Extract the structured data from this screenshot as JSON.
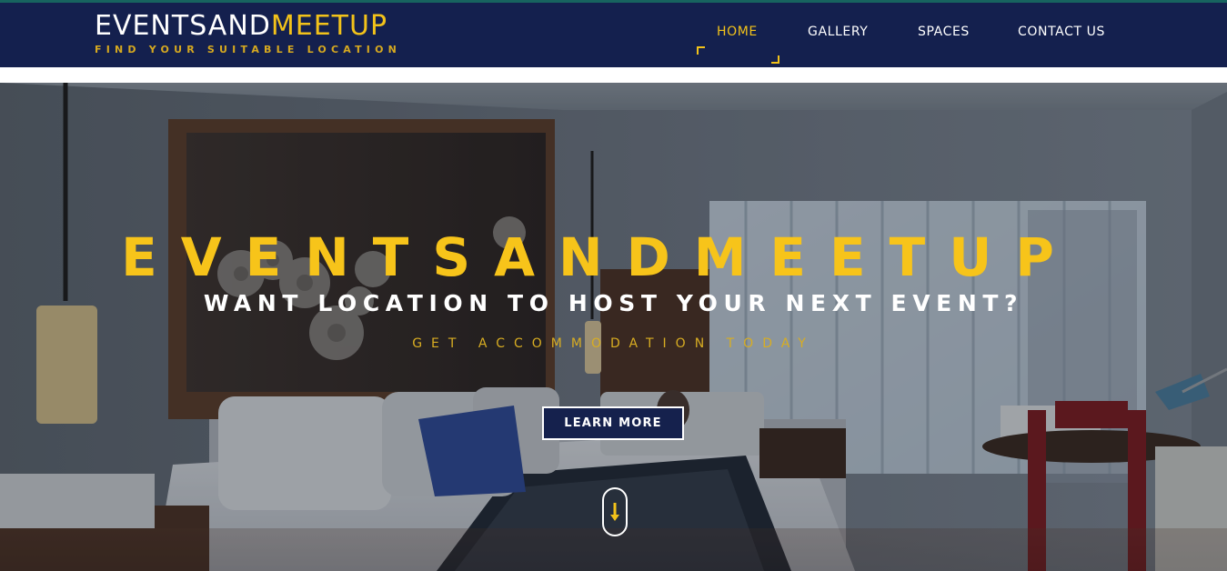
{
  "brand": {
    "title_part1": "EVENTSAND",
    "title_part2": "MEETUP",
    "tagline": "FIND YOUR SUITABLE LOCATION"
  },
  "nav": {
    "items": [
      {
        "label": "HOME",
        "active": true
      },
      {
        "label": "GALLERY",
        "active": false
      },
      {
        "label": "SPACES",
        "active": false
      },
      {
        "label": "CONTACT US",
        "active": false
      }
    ]
  },
  "hero": {
    "title": "EVENTSANDMEETUP",
    "subtitle": "WANT LOCATION TO HOST YOUR NEXT EVENT?",
    "tagline": "GET ACCOMMODATION TODAY",
    "cta_label": "LEARN MORE",
    "scroll_icon": "arrow-down-icon",
    "background": "hotel-bedroom-photo"
  },
  "colors": {
    "navbar": "#14204e",
    "accent": "#f2c21a",
    "top_stripe": "#17645f",
    "button_bg": "#15214d"
  }
}
